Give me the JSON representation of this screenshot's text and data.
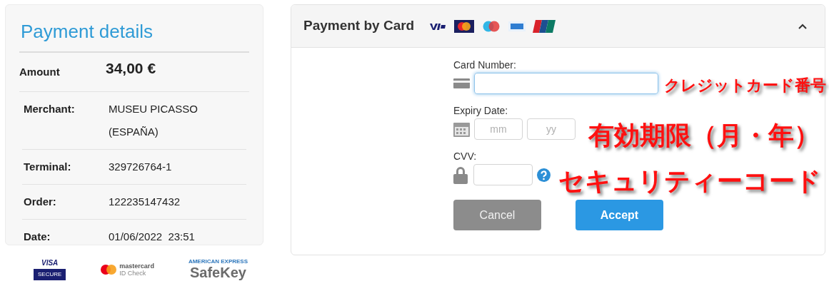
{
  "details": {
    "title": "Payment details",
    "rows": [
      {
        "kind": "amount",
        "label": "Amount",
        "value": "34,00 €"
      },
      {
        "kind": "plain",
        "label": "Merchant:",
        "value": "MUSEU PICASSO (ESPAÑA)"
      },
      {
        "kind": "plain",
        "label": "Terminal:",
        "value": "329726764-1"
      },
      {
        "kind": "plain",
        "label": "Order:",
        "value": "122235147432"
      },
      {
        "kind": "plain",
        "label": "Date:",
        "value": "01/06/2022  23:51"
      }
    ]
  },
  "badges": [
    {
      "kind": "visa-secure",
      "lines": [
        "VISA",
        "SECURE"
      ]
    },
    {
      "kind": "mastercard",
      "lines": [
        "mastercard",
        "ID Check"
      ]
    },
    {
      "kind": "safekey",
      "lines": [
        "AMERICAN EXPRESS",
        "SafeKey"
      ]
    }
  ],
  "card_panel": {
    "title": "Payment by Card",
    "expanded": true,
    "fields": [
      {
        "kind": "card",
        "label": "Card Number:",
        "focused": true
      },
      {
        "kind": "expiry",
        "label": "Expiry Date:",
        "placeholders": [
          "mm",
          "yy"
        ]
      },
      {
        "kind": "cvv",
        "label": "CVV:"
      }
    ],
    "buttons": [
      {
        "kind": "cancel",
        "label": "Cancel"
      },
      {
        "kind": "accept",
        "label": "Accept"
      }
    ]
  },
  "annotations": [
    "クレジットカード番号",
    "有効期限（月・年）",
    "セキュリティーコード"
  ]
}
